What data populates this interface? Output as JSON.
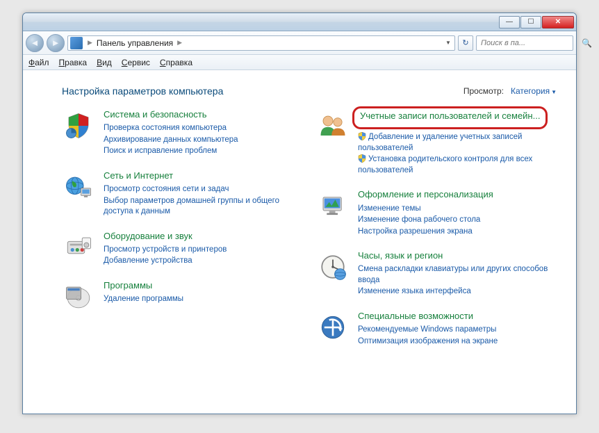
{
  "titlebar": {
    "min": "—",
    "max": "☐",
    "close": "✕"
  },
  "nav": {
    "back": "◄",
    "forward": "►",
    "breadcrumb_root": "Панель управления",
    "refresh": "↻",
    "search_placeholder": "Поиск в па...",
    "search_glyph": "🔍"
  },
  "menu": {
    "file": "Файл",
    "edit": "Правка",
    "view": "Вид",
    "tools": "Сервис",
    "help": "Справка"
  },
  "header": {
    "title": "Настройка параметров компьютера",
    "view_label": "Просмотр:",
    "view_value": "Категория"
  },
  "categories": {
    "left": [
      {
        "id": "system-security",
        "title": "Система и безопасность",
        "links": [
          {
            "text": "Проверка состояния компьютера",
            "shield": false
          },
          {
            "text": "Архивирование данных компьютера",
            "shield": false
          },
          {
            "text": "Поиск и исправление проблем",
            "shield": false
          }
        ]
      },
      {
        "id": "network-internet",
        "title": "Сеть и Интернет",
        "links": [
          {
            "text": "Просмотр состояния сети и задач",
            "shield": false
          },
          {
            "text": "Выбор параметров домашней группы и общего доступа к данным",
            "shield": false
          }
        ]
      },
      {
        "id": "hardware-sound",
        "title": "Оборудование и звук",
        "links": [
          {
            "text": "Просмотр устройств и принтеров",
            "shield": false
          },
          {
            "text": "Добавление устройства",
            "shield": false
          }
        ]
      },
      {
        "id": "programs",
        "title": "Программы",
        "links": [
          {
            "text": "Удаление программы",
            "shield": false
          }
        ]
      }
    ],
    "right": [
      {
        "id": "user-accounts",
        "title": "Учетные записи пользователей и семейн...",
        "highlighted": true,
        "links": [
          {
            "text": "Добавление и удаление учетных записей пользователей",
            "shield": true
          },
          {
            "text": "Установка родительского контроля для всех пользователей",
            "shield": true
          }
        ]
      },
      {
        "id": "appearance",
        "title": "Оформление и персонализация",
        "links": [
          {
            "text": "Изменение темы",
            "shield": false
          },
          {
            "text": "Изменение фона рабочего стола",
            "shield": false
          },
          {
            "text": "Настройка разрешения экрана",
            "shield": false
          }
        ]
      },
      {
        "id": "clock-lang-region",
        "title": "Часы, язык и регион",
        "links": [
          {
            "text": "Смена раскладки клавиатуры или других способов ввода",
            "shield": false
          },
          {
            "text": "Изменение языка интерфейса",
            "shield": false
          }
        ]
      },
      {
        "id": "ease-of-access",
        "title": "Специальные возможности",
        "links": [
          {
            "text": "Рекомендуемые Windows параметры",
            "shield": false
          },
          {
            "text": "Оптимизация изображения на экране",
            "shield": false
          }
        ]
      }
    ]
  }
}
